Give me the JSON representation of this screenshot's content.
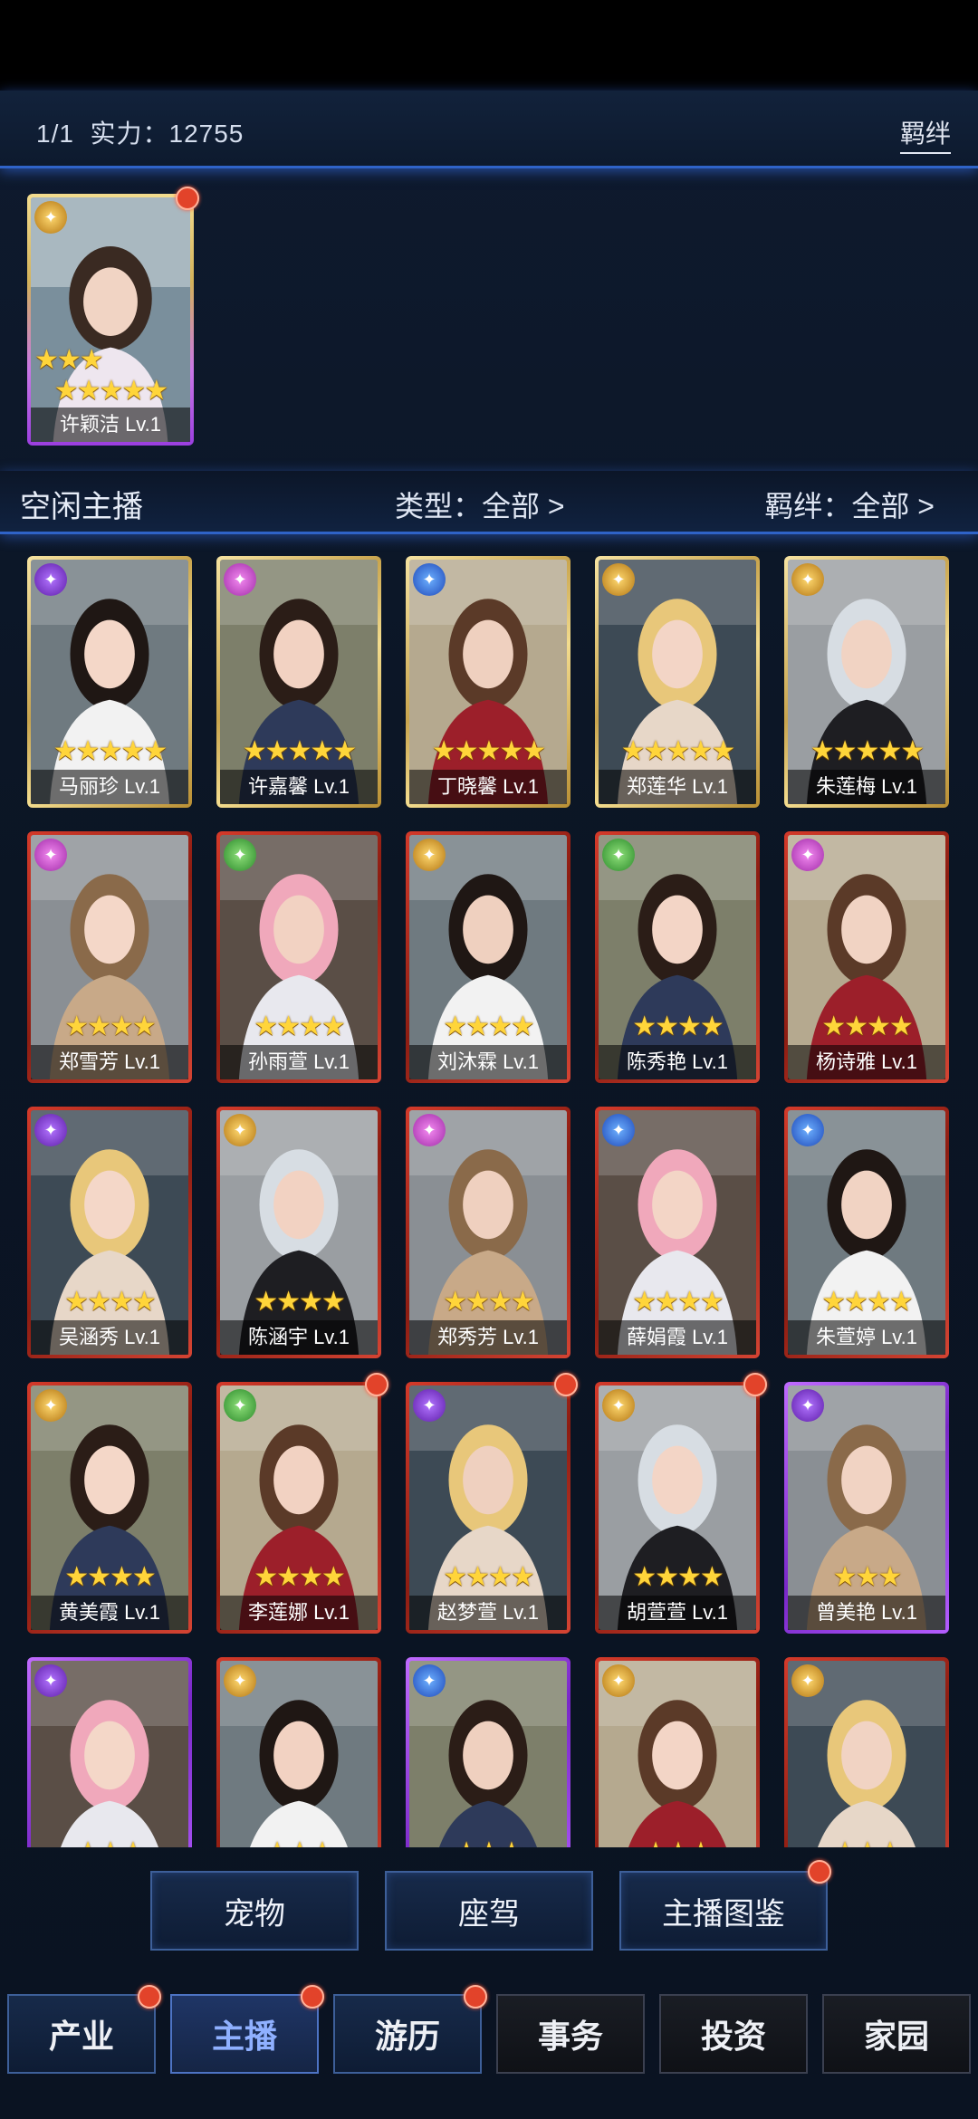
{
  "header": {
    "page": "1/1",
    "power_label": "实力：",
    "power_value": "12755",
    "bond_link": "羁绊"
  },
  "active_slot": {
    "name": "许颖洁 Lv.1",
    "stars_row1": "★★★",
    "stars_row2": "★★★★★"
  },
  "filter": {
    "idle_label": "空闲主播",
    "type_filter": "类型：全部 >",
    "bond_filter": "羁绊：全部 >"
  },
  "streamers": [
    {
      "name": "马丽珍 Lv.1",
      "stars": "★★★★★"
    },
    {
      "name": "许嘉馨 Lv.1",
      "stars": "★★★★★"
    },
    {
      "name": "丁晓馨 Lv.1",
      "stars": "★★★★★"
    },
    {
      "name": "郑莲华 Lv.1",
      "stars": "★★★★★"
    },
    {
      "name": "朱莲梅 Lv.1",
      "stars": "★★★★★"
    },
    {
      "name": "郑雪芳 Lv.1",
      "stars": "★★★★"
    },
    {
      "name": "孙雨萱 Lv.1",
      "stars": "★★★★"
    },
    {
      "name": "刘沐霖 Lv.1",
      "stars": "★★★★"
    },
    {
      "name": "陈秀艳 Lv.1",
      "stars": "★★★★"
    },
    {
      "name": "杨诗雅 Lv.1",
      "stars": "★★★★"
    },
    {
      "name": "吴涵秀 Lv.1",
      "stars": "★★★★"
    },
    {
      "name": "陈涵宇 Lv.1",
      "stars": "★★★★"
    },
    {
      "name": "郑秀芳 Lv.1",
      "stars": "★★★★"
    },
    {
      "name": "薛娟霞 Lv.1",
      "stars": "★★★★"
    },
    {
      "name": "朱萱婷 Lv.1",
      "stars": "★★★★"
    },
    {
      "name": "黄美霞 Lv.1",
      "stars": "★★★★"
    },
    {
      "name": "李莲娜 Lv.1",
      "stars": "★★★★"
    },
    {
      "name": "赵梦萱 Lv.1",
      "stars": "★★★★"
    },
    {
      "name": "胡萱萱 Lv.1",
      "stars": "★★★★"
    },
    {
      "name": "曾美艳 Lv.1",
      "stars": "★★★"
    },
    {
      "name": "",
      "stars": "★★★"
    },
    {
      "name": "",
      "stars": "★★★"
    },
    {
      "name": "",
      "stars": "★★★"
    },
    {
      "name": "",
      "stars": "★★★"
    },
    {
      "name": "",
      "stars": "★★★"
    }
  ],
  "bottom_buttons": {
    "pet": "宠物",
    "mount": "座驾",
    "gallery": "主播图鉴"
  },
  "nav": {
    "industry": "产业",
    "streamer": "主播",
    "travel": "游历",
    "affairs": "事务",
    "invest": "投资",
    "home": "家园"
  },
  "icons": {
    "badge": "emblem-icon",
    "star": "star-icon",
    "notification": "red-dot-icon"
  },
  "colors": {
    "accent": "#2f63c8",
    "active_tab": "#8fb0ff",
    "notification": "#e2432a",
    "star": "#ffd53a"
  }
}
